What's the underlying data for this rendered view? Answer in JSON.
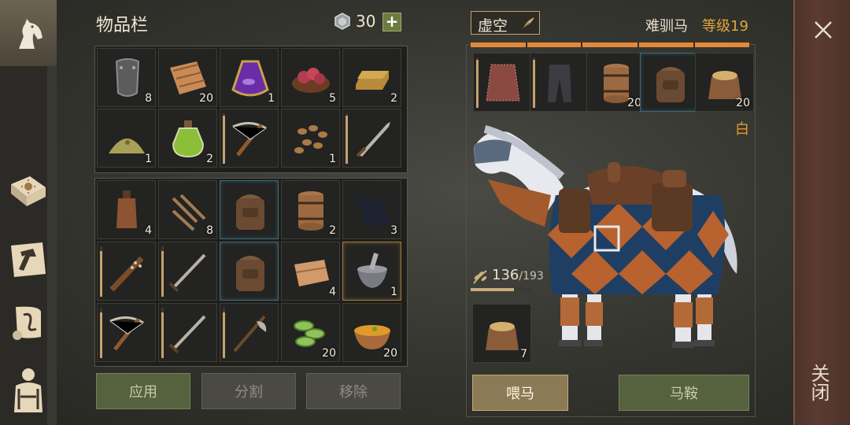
{
  "inventory": {
    "title": "物品栏",
    "currency": {
      "icon": "gem-coin-icon",
      "count": "30",
      "add_label": "+"
    },
    "top_grid": [
      {
        "icon": "metal-plate-armor-icon",
        "qty": "8"
      },
      {
        "icon": "cloth-bundle-icon",
        "qty": "20"
      },
      {
        "icon": "purple-potion-flask-icon",
        "qty": "1"
      },
      {
        "icon": "raw-meat-bowl-icon",
        "qty": "5"
      },
      {
        "icon": "gold-ingot-icon",
        "qty": "2"
      },
      {
        "icon": "herb-powder-pile-icon",
        "qty": "1"
      },
      {
        "icon": "green-potion-bottle-icon",
        "qty": "2"
      },
      {
        "icon": "crossbow-icon",
        "qty": ""
      },
      {
        "icon": "seeds-pile-icon",
        "qty": "1"
      },
      {
        "icon": "sword-icon",
        "qty": ""
      }
    ],
    "bottom_grid": [
      {
        "icon": "leather-flask-icon",
        "qty": "4"
      },
      {
        "icon": "iron-nails-icon",
        "qty": "8"
      },
      {
        "icon": "backpack-icon",
        "qty": ""
      },
      {
        "icon": "wooden-barrel-icon",
        "qty": "2"
      },
      {
        "icon": "coal-lumps-icon",
        "qty": "3"
      },
      {
        "icon": "spiked-club-icon",
        "qty": ""
      },
      {
        "icon": "long-sword-icon",
        "qty": ""
      },
      {
        "icon": "backpack-icon",
        "qty": ""
      },
      {
        "icon": "folded-cloth-icon",
        "qty": "4"
      },
      {
        "icon": "mortar-pestle-icon",
        "qty": "1"
      },
      {
        "icon": "crossbow-icon",
        "qty": ""
      },
      {
        "icon": "long-sword-icon",
        "qty": ""
      },
      {
        "icon": "halberd-icon",
        "qty": ""
      },
      {
        "icon": "green-slices-icon",
        "qty": "20"
      },
      {
        "icon": "soup-bowl-icon",
        "qty": "20"
      }
    ],
    "buttons": {
      "apply": "应用",
      "split": "分割",
      "remove": "移除"
    }
  },
  "horse": {
    "name": "虚空",
    "edit_icon": "quill-edit-icon",
    "type": "难驯马",
    "level": "等级19",
    "color_name": "白",
    "equipment": [
      {
        "icon": "red-chainmail-armor-icon",
        "qty": ""
      },
      {
        "icon": "dark-leggings-icon",
        "qty": ""
      },
      {
        "icon": "wooden-barrel-icon",
        "qty": "20"
      },
      {
        "icon": "backpack-icon",
        "qty": ""
      },
      {
        "icon": "grain-sack-icon",
        "qty": "20"
      }
    ],
    "food": {
      "icon": "wheat-icon",
      "current": "136",
      "max": "/193",
      "fraction": 0.705
    },
    "food_slot": {
      "icon": "grain-sack-icon",
      "qty": "7"
    },
    "buttons": {
      "feed": "喂马",
      "saddle": "马鞍"
    }
  },
  "nav": {
    "items": [
      "horse-head-icon",
      "recipe-book-icon",
      "crafting-hammer-icon",
      "scroll-map-icon",
      "character-gear-icon"
    ]
  },
  "close": {
    "label": "关闭",
    "icon": "close-x-icon"
  },
  "colors": {
    "accent_gold": "#e2a63d",
    "bar_orange": "#e28a3a",
    "button_green": "#56613e",
    "close_strip": "#5b3a30"
  }
}
